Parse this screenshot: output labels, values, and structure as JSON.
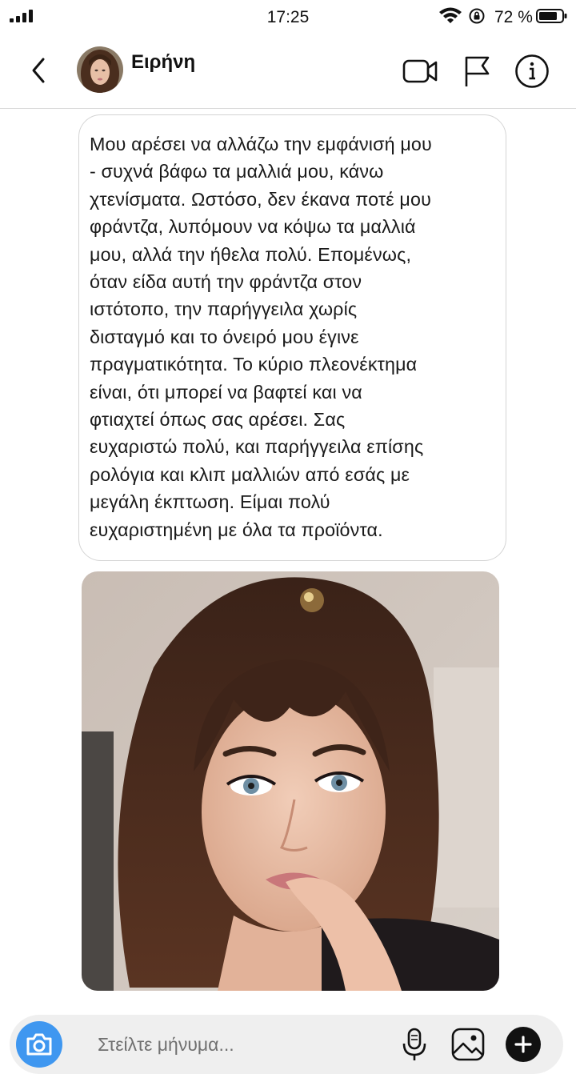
{
  "status_bar": {
    "time": "17:25",
    "battery_percent": "72 %",
    "icons": [
      "signal-icon",
      "wifi-icon",
      "rotation-lock-icon",
      "battery-icon"
    ]
  },
  "header": {
    "contact_name": "Ειρήνη",
    "icons": [
      "back-chevron-icon",
      "video-call-icon",
      "flag-icon",
      "info-icon"
    ]
  },
  "message": {
    "lines": [
      "Μου αρέσει να αλλάζω την εμφάνισή μου",
      "- συχνά βάφω τα μαλλιά μου, κάνω",
      "χτενίσματα. Ωστόσο, δεν έκανα ποτέ μου",
      "φράντζα, λυπόμουν να κόψω τα μαλλιά",
      "μου, αλλά την ήθελα πολύ. Επομένως,",
      "όταν είδα αυτή την φράντζα στον",
      "ιστότοπο, την παρήγγειλα χωρίς",
      "δισταγμό και το όνειρό μου έγινε",
      "πραγματικότητα. Το κύριο πλεονέκτημα",
      "είναι, ότι μπορεί να βαφτεί και να",
      "φτιαχτεί όπως σας αρέσει. Σας",
      "ευχαριστώ πολύ, και παρήγγειλα επίσης",
      "ρολόγια και κλιπ μαλλιών από εσάς με",
      "μεγάλη έκπτωση. Είμαι πολύ",
      "ευχαριστημένη με όλα τα προϊόντα."
    ]
  },
  "composer": {
    "placeholder": "Στείλτε μήνυμα...",
    "icons": [
      "camera-icon",
      "microphone-icon",
      "gallery-icon",
      "plus-icon"
    ]
  },
  "colors": {
    "accent_blue": "#3f97f0",
    "bubble_border": "#d4d4d4",
    "composer_bg": "#efefef"
  }
}
